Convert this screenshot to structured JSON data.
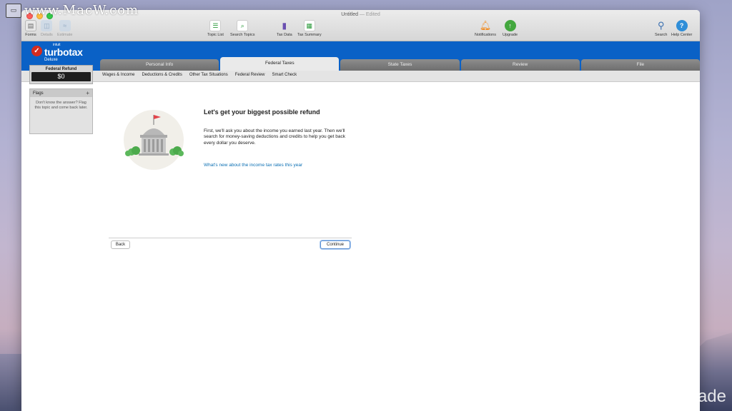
{
  "watermarks": {
    "top_text": "www.MacW.com",
    "bottom_text": "Warmasjade"
  },
  "window": {
    "title": "Untitled",
    "title_suffix": "— Edited"
  },
  "toolbar": {
    "forms": "Forms",
    "details": "Details",
    "estimate": "Estimate",
    "topic_list": "Topic List",
    "search_topics": "Search Topics",
    "tax_data": "Tax Data",
    "tax_summary": "Tax Summary",
    "notifications": "Notifications",
    "upgrade": "Upgrade",
    "search": "Search",
    "help_center": "Help Center"
  },
  "brand": {
    "intuit": "intuit",
    "name": "turbotax",
    "edition": "Deluxe"
  },
  "tabs": [
    {
      "label": "Personal Info"
    },
    {
      "label": "Federal Taxes"
    },
    {
      "label": "State Taxes"
    },
    {
      "label": "Review"
    },
    {
      "label": "File"
    }
  ],
  "subnav": [
    "Wages & Income",
    "Deductions & Credits",
    "Other Tax Situations",
    "Federal Review",
    "Smart Check"
  ],
  "sidebar": {
    "refund_label": "Federal Refund",
    "refund_value": "$0",
    "flags_title": "Flags",
    "flags_plus": "+",
    "flags_text": "Don't know the answer? Flag this topic and come back later."
  },
  "main": {
    "headline": "Let's get your biggest possible refund",
    "body": "First, we'll ask you about the income you earned last year. Then we'll search for money-saving deductions and credits to help you get back every dollar you deserve.",
    "link": "What's new about the income tax rates this year",
    "back_button": "Back",
    "continue_button": "Continue"
  },
  "colors": {
    "brand_blue": "#0a61c6",
    "link_blue": "#0b6fb3",
    "logo_red": "#d52b1e"
  }
}
